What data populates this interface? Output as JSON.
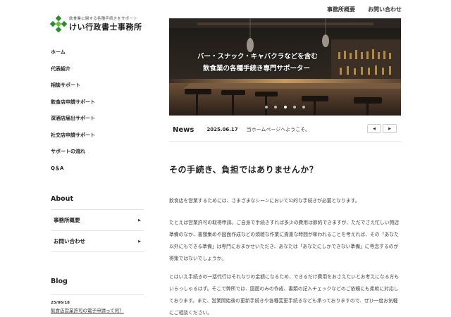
{
  "header": {
    "nav": [
      "事務所概要",
      "お問い合わせ"
    ]
  },
  "logo": {
    "tagline": "飲食業に関する各種手続きをサポート",
    "name": "けい行政書士事務所",
    "brand_color": "#2e8b2e"
  },
  "sidebar": {
    "items": [
      {
        "label": "ホーム"
      },
      {
        "label": "代表紹介"
      },
      {
        "label": "相談サポート"
      },
      {
        "label": "飲食店申請サポート"
      },
      {
        "label": "深酒店届出サポート"
      },
      {
        "label": "社交店申請サポート"
      },
      {
        "label": "サポートの流れ"
      },
      {
        "label": "Q＆A"
      }
    ]
  },
  "about": {
    "title": "About",
    "items": [
      {
        "label": "事務所概要",
        "icon": "triangle-right-icon"
      },
      {
        "label": "お問い合わせ",
        "icon": "triangle-right-icon"
      }
    ]
  },
  "blog": {
    "title": "Blog",
    "entries": [
      {
        "date": "25/06/18",
        "title": "飲食店営業許可の電子申請って何？"
      }
    ]
  },
  "hero": {
    "line1": "バー・スナック・キャバクラなどを含む",
    "line2": "飲食業の各種手続き専門サポーター",
    "slides": 5,
    "active_slide": 2
  },
  "news": {
    "label": "News",
    "date": "2025.06.17",
    "text": "当ホームページへようこそ。",
    "prev_icon": "triangle-left-icon",
    "next_icon": "triangle-right-icon"
  },
  "main": {
    "heading": "その手続き、負担ではありませんか？",
    "paragraphs": [
      "飲食店を営業するためには、さまざまなシーンにおいて公的な手続きが必要となります。",
      "たとえば営業許可の取得申請。ご自身で手続きすれば多少の費用は節約できますが、ただでさえ忙しい開店準備のなか、書類集めや図面作成などの煩雑な作業に貴重な時間が奪われることを考えれば、その「あなた以外にもできる準備」は専門におまかせいただき、あなたは「あなたにしかできない準備」に専念するのが得策ではないでしょうか。",
      "とはいえ手続きの一括代行はそれなりの金額になるため、できるだけ費用をおさえたいとお考えになる方もいらっしゃるはず。そこで弊所では、図面のみの作成、書類の記入チェックなどのご依頼にも柔軟に対応しております。また、営業開始後の更新手続きや各種変更手続きなども承っておりますので、ぜひ一度お気軽にご相談ください。"
    ]
  }
}
